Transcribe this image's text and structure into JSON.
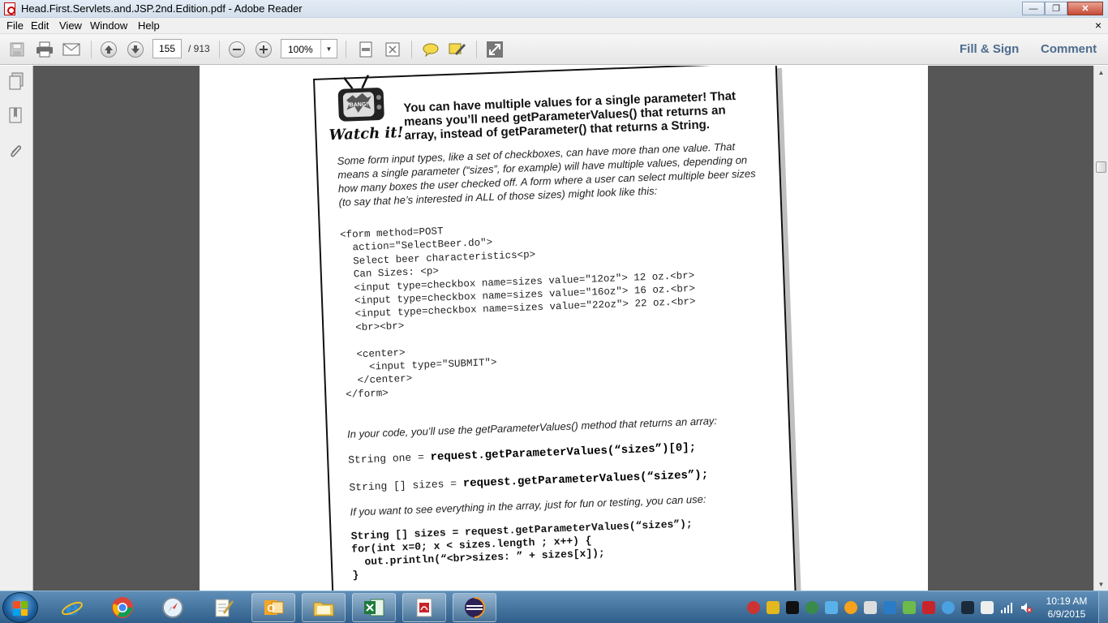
{
  "window": {
    "title": "Head.First.Servlets.and.JSP.2nd.Edition.pdf - Adobe Reader",
    "close_doc": "×"
  },
  "menu": {
    "items": [
      "File",
      "Edit",
      "View",
      "Window",
      "Help"
    ]
  },
  "toolbar": {
    "page_current": "155",
    "page_total": "/ 913",
    "zoom": "100%",
    "fill_sign": "Fill & Sign",
    "comment": "Comment"
  },
  "page": {
    "badge": "BANG!",
    "watch_label": "Watch it!",
    "heading": "You can have multiple values for a single parameter! That means you’ll need getParameterValues() that returns an array, instead of getParameter() that returns a String.",
    "intro": "Some form input types, like a set of checkboxes, can have more than one value. That means a single parameter (“sizes”, for example) will have multiple values, depending on how many boxes the user checked off. A form where a user can select multiple beer sizes (to say that he’s interested in ALL of those sizes) might look like this:",
    "form_code": "<form method=POST\n  action=\"SelectBeer.do\">\n  Select beer characteristics<p>\n  Can Sizes: <p>\n  <input type=checkbox name=sizes value=\"12oz\"> 12 oz.<br>\n  <input type=checkbox name=sizes value=\"16oz\"> 16 oz.<br>\n  <input type=checkbox name=sizes value=\"22oz\"> 22 oz.<br>\n  <br><br>\n\n  <center>\n    <input type=\"SUBMIT\">\n  </center>\n</form>",
    "code_note": "In your code, you’ll use the getParameterValues() method that returns an array:",
    "line1_prefix": "String one = ",
    "line1_call": "request.getParameterValues(“sizes”)[0];",
    "line2_prefix": "String [] sizes = ",
    "line2_call": "request.getParameterValues(“sizes”);",
    "fun_note": "If you want to see everything in the array, just for fun or testing, you can use:",
    "loop_code": "String [] sizes = request.getParameterValues(“sizes”);\nfor(int x=0; x < sizes.length ; x++) {\n  out.println(“<br>sizes: ” + sizes[x]);\n}"
  },
  "taskbar": {
    "apps": [
      "internet-explorer",
      "chrome",
      "safari",
      "notepad",
      "outlook",
      "file-explorer",
      "excel",
      "adobe-reader",
      "eclipse"
    ],
    "time": "10:19 AM",
    "date": "6/9/2015"
  }
}
